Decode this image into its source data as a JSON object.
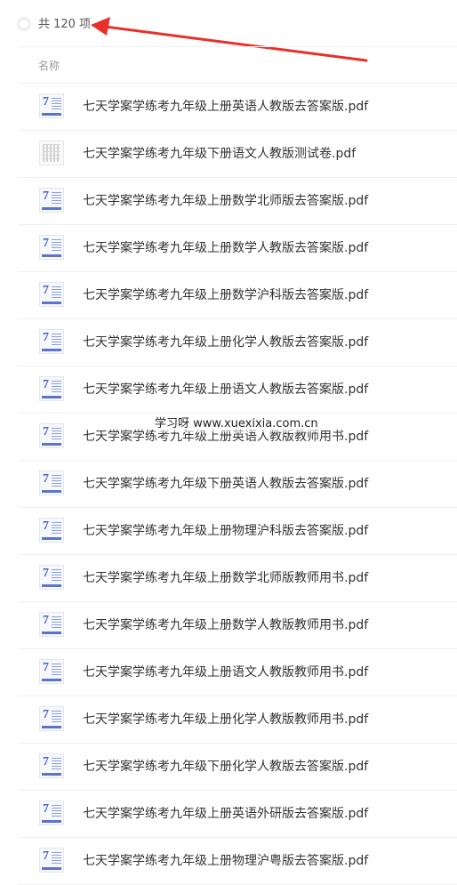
{
  "header": {
    "count_label": "共 120 项",
    "column_name": "名称"
  },
  "colors": {
    "arrow": "#e8302a",
    "thumbnail_accent": "#4a63c8"
  },
  "files": [
    {
      "name": "七天学案学练考九年级上册英语人教版去答案版.pdf",
      "thumb": "cover"
    },
    {
      "name": "七天学案学练考九年级下册语文人教版测试卷.pdf",
      "thumb": "doc"
    },
    {
      "name": "七天学案学练考九年级上册数学北师版去答案版.pdf",
      "thumb": "cover"
    },
    {
      "name": "七天学案学练考九年级上册数学人教版去答案版.pdf",
      "thumb": "cover"
    },
    {
      "name": "七天学案学练考九年级上册数学沪科版去答案版.pdf",
      "thumb": "cover"
    },
    {
      "name": "七天学案学练考九年级上册化学人教版去答案版.pdf",
      "thumb": "cover"
    },
    {
      "name": "七天学案学练考九年级上册语文人教版去答案版.pdf",
      "thumb": "cover"
    },
    {
      "name": "七天学案学练考九年级上册英语人教版教师用书.pdf",
      "thumb": "cover"
    },
    {
      "name": "七天学案学练考九年级下册英语人教版去答案版.pdf",
      "thumb": "cover"
    },
    {
      "name": "七天学案学练考九年级上册物理沪科版去答案版.pdf",
      "thumb": "cover"
    },
    {
      "name": "七天学案学练考九年级上册数学北师版教师用书.pdf",
      "thumb": "cover"
    },
    {
      "name": "七天学案学练考九年级上册数学人教版教师用书.pdf",
      "thumb": "cover"
    },
    {
      "name": "七天学案学练考九年级上册语文人教版教师用书.pdf",
      "thumb": "cover"
    },
    {
      "name": "七天学案学练考九年级上册化学人教版教师用书.pdf",
      "thumb": "cover"
    },
    {
      "name": "七天学案学练考九年级下册化学人教版去答案版.pdf",
      "thumb": "cover"
    },
    {
      "name": "七天学案学练考九年级上册英语外研版去答案版.pdf",
      "thumb": "cover"
    },
    {
      "name": "七天学案学练考九年级上册物理沪粤版去答案版.pdf",
      "thumb": "cover"
    }
  ],
  "watermark": "学习呀 www.xuexixia.com.cn"
}
